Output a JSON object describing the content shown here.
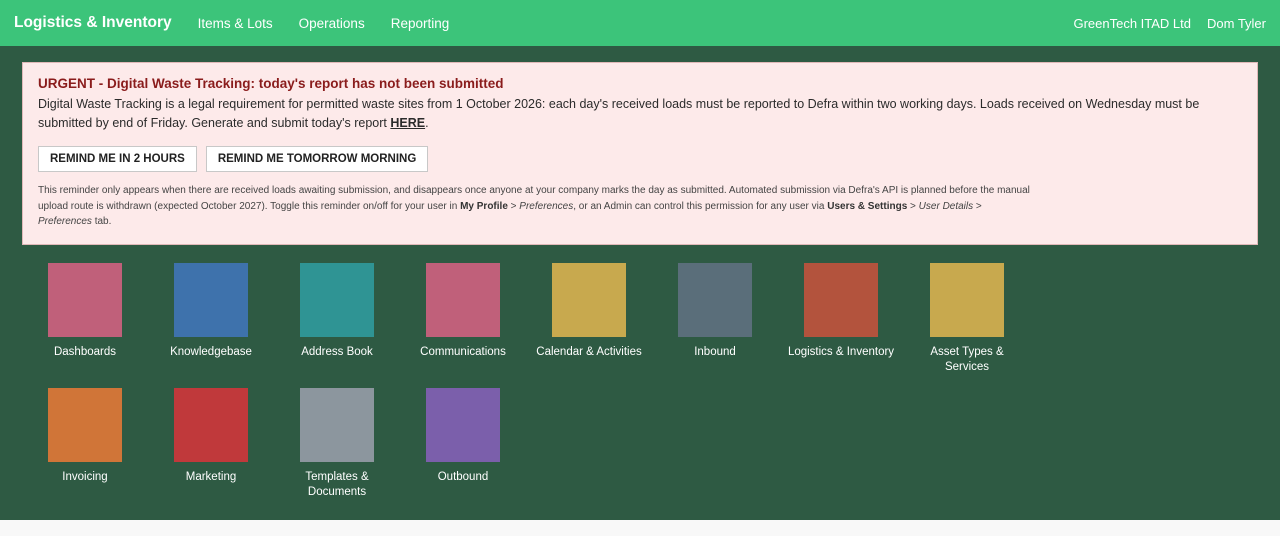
{
  "navbar": {
    "brand": "Logistics & Inventory",
    "items": [
      "Items & Lots",
      "Operations",
      "Reporting"
    ],
    "company": "GreenTech ITAD Ltd",
    "user": "Dom Tyler"
  },
  "alert": {
    "title": "URGENT - Digital Waste Tracking: today's report has not been submitted",
    "body": "Digital Waste Tracking is a legal requirement for permitted waste sites from 1 October 2026: each day's received loads must be reported to Defra within two working days. Loads received on Wednesday must be submitted by end of Friday. Generate and submit today's report ",
    "link": "HERE",
    "body_end": ".",
    "button_1": "REMIND ME IN 2 HOURS",
    "button_2": "REMIND ME TOMORROW MORNING",
    "note_1": "This reminder only appears when there are received loads awaiting submission, and disappears once anyone at your company marks the day as submitted. Automated submission via Defra's API is planned before the manual upload route is withdrawn (expected October 2027). Toggle this reminder on/off for your user in ",
    "note_my_profile": "My Profile",
    "note_2": " > ",
    "note_preferences": "Preferences",
    "note_3": ", or an Admin can control this permission for any user via ",
    "note_users_settings": "Users & Settings",
    "note_4": " > ",
    "note_user_details": "User Details",
    "note_5": " > ",
    "note_preferences_2": "Preferences",
    "note_6": " tab."
  },
  "apps": [
    {
      "label": "Dashboards",
      "color": "#c0607a"
    },
    {
      "label": "Knowledgebase",
      "color": "#3e72ac"
    },
    {
      "label": "Address Book",
      "color": "#2f9494"
    },
    {
      "label": "Communications",
      "color": "#c0607a"
    },
    {
      "label": "Calendar & Activities",
      "color": "#c8a94e"
    },
    {
      "label": "Inbound",
      "color": "#5a6e7a"
    },
    {
      "label": "Logistics & Inventory",
      "color": "#b3533d"
    },
    {
      "label": "Asset Types & Services",
      "color": "#c8a94e"
    },
    {
      "label": "Invoicing",
      "color": "#d07538"
    },
    {
      "label": "Marketing",
      "color": "#c0393b"
    },
    {
      "label": "Templates & Documents",
      "color": "#8c969e"
    },
    {
      "label": "Outbound",
      "color": "#7b5fab"
    }
  ]
}
